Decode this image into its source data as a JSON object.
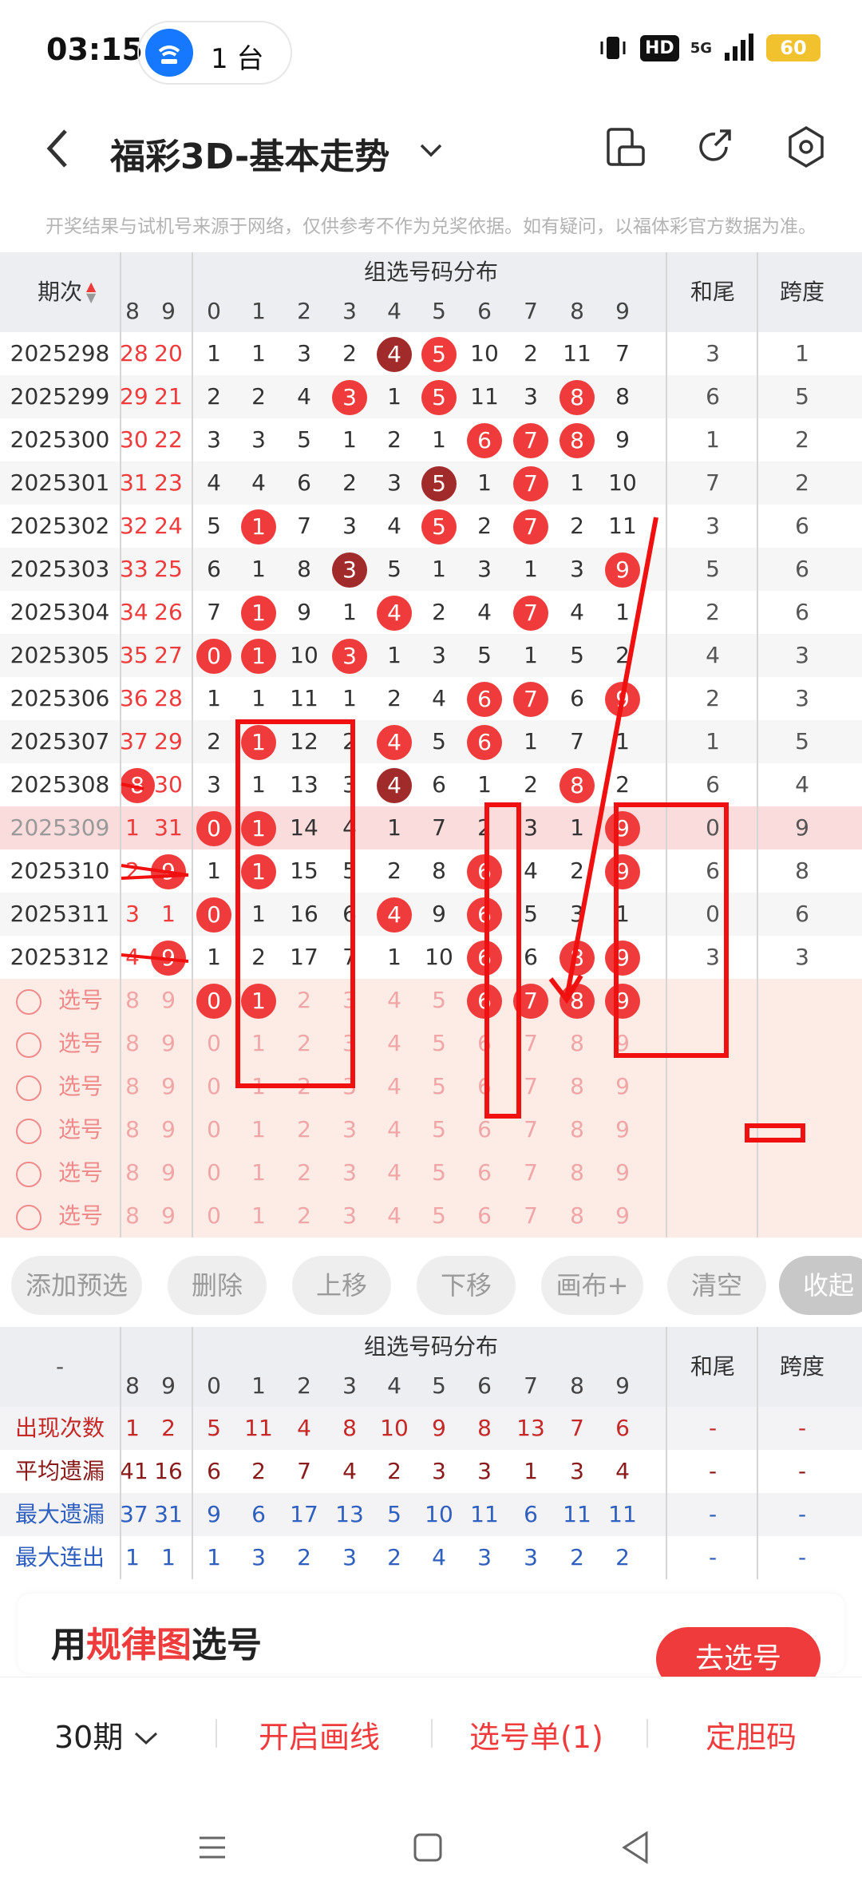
{
  "status": {
    "time": "03:15",
    "hotspot_count": "1 台",
    "network": "5G",
    "hd": "HD",
    "battery": "60"
  },
  "nav": {
    "title": "福彩3D-基本走势"
  },
  "notice": "开奖结果与试机号来源于网络，仅供参考不作为兑奖依据。如有疑问，以福体彩官方数据为准。",
  "table": {
    "col_period": "期次",
    "group_title": "组选号码分布",
    "col_sum_tail": "和尾",
    "col_span": "跨度",
    "sub_headers": [
      "8",
      "9",
      "0",
      "1",
      "2",
      "3",
      "4",
      "5",
      "6",
      "7",
      "8",
      "9"
    ],
    "rows": [
      {
        "period": "2025298",
        "c8": "28",
        "c9": "20",
        "d": [
          "1",
          "1",
          "3",
          "2",
          "4",
          "5",
          "10",
          "2",
          "11",
          "7"
        ],
        "tail": "3",
        "span": "1"
      },
      {
        "period": "2025299",
        "c8": "29",
        "c9": "21",
        "d": [
          "2",
          "2",
          "4",
          "3",
          "1",
          "5",
          "11",
          "3",
          "8",
          "8"
        ],
        "tail": "6",
        "span": "5"
      },
      {
        "period": "2025300",
        "c8": "30",
        "c9": "22",
        "d": [
          "3",
          "3",
          "5",
          "1",
          "2",
          "1",
          "6",
          "7",
          "8",
          "9"
        ],
        "tail": "1",
        "span": "2"
      },
      {
        "period": "2025301",
        "c8": "31",
        "c9": "23",
        "d": [
          "4",
          "4",
          "6",
          "2",
          "3",
          "5",
          "1",
          "7",
          "1",
          "10"
        ],
        "tail": "7",
        "span": "2"
      },
      {
        "period": "2025302",
        "c8": "32",
        "c9": "24",
        "d": [
          "5",
          "1",
          "7",
          "3",
          "4",
          "5",
          "2",
          "7",
          "2",
          "11"
        ],
        "tail": "3",
        "span": "6"
      },
      {
        "period": "2025303",
        "c8": "33",
        "c9": "25",
        "d": [
          "6",
          "1",
          "8",
          "3",
          "5",
          "1",
          "3",
          "1",
          "3",
          "9"
        ],
        "tail": "5",
        "span": "6"
      },
      {
        "period": "2025304",
        "c8": "34",
        "c9": "26",
        "d": [
          "7",
          "1",
          "9",
          "1",
          "4",
          "2",
          "4",
          "7",
          "4",
          "1"
        ],
        "tail": "2",
        "span": "6"
      },
      {
        "period": "2025305",
        "c8": "35",
        "c9": "27",
        "d": [
          "0",
          "1",
          "10",
          "3",
          "1",
          "3",
          "5",
          "1",
          "5",
          "2"
        ],
        "tail": "4",
        "span": "3"
      },
      {
        "period": "2025306",
        "c8": "36",
        "c9": "28",
        "d": [
          "1",
          "1",
          "11",
          "1",
          "2",
          "4",
          "6",
          "7",
          "6",
          "9"
        ],
        "tail": "2",
        "span": "3"
      },
      {
        "period": "2025307",
        "c8": "37",
        "c9": "29",
        "d": [
          "2",
          "1",
          "12",
          "2",
          "4",
          "5",
          "6",
          "1",
          "7",
          "1"
        ],
        "tail": "1",
        "span": "5"
      },
      {
        "period": "2025308",
        "c8": "8",
        "c9": "30",
        "d": [
          "3",
          "1",
          "13",
          "3",
          "4",
          "6",
          "1",
          "2",
          "8",
          "2"
        ],
        "tail": "6",
        "span": "4"
      },
      {
        "period": "2025309",
        "c8": "1",
        "c9": "31",
        "d": [
          "0",
          "1",
          "14",
          "4",
          "1",
          "7",
          "2",
          "3",
          "1",
          "9"
        ],
        "tail": "0",
        "span": "9"
      },
      {
        "period": "2025310",
        "c8": "2",
        "c9": "9",
        "d": [
          "1",
          "1",
          "15",
          "5",
          "2",
          "8",
          "6",
          "4",
          "2",
          "9"
        ],
        "tail": "6",
        "span": "8"
      },
      {
        "period": "2025311",
        "c8": "3",
        "c9": "1",
        "d": [
          "0",
          "1",
          "16",
          "6",
          "4",
          "9",
          "6",
          "5",
          "3",
          "1"
        ],
        "tail": "0",
        "span": "6"
      },
      {
        "period": "2025312",
        "c8": "4",
        "c9": "9",
        "d": [
          "1",
          "2",
          "17",
          "7",
          "1",
          "10",
          "6",
          "6",
          "8",
          "9"
        ],
        "tail": "3",
        "span": "3"
      }
    ],
    "select_label": "选号",
    "select_rows": 6
  },
  "buttons": [
    "添加预选",
    "删除",
    "上移",
    "下移",
    "画布+",
    "清空",
    "收起"
  ],
  "stats": {
    "dash": "-",
    "group_title": "组选号码分布",
    "col_sum_tail": "和尾",
    "col_span": "跨度",
    "rows": [
      {
        "label": "出现次数",
        "vals": [
          "1",
          "2",
          "5",
          "11",
          "4",
          "8",
          "10",
          "9",
          "8",
          "13",
          "7",
          "6"
        ],
        "tail": "-",
        "span": "-",
        "color": "#c62828"
      },
      {
        "label": "平均遗漏",
        "vals": [
          "41",
          "16",
          "6",
          "2",
          "7",
          "4",
          "2",
          "3",
          "3",
          "1",
          "3",
          "4"
        ],
        "tail": "-",
        "span": "-",
        "color": "#8b1a1a"
      },
      {
        "label": "最大遗漏",
        "vals": [
          "37",
          "31",
          "9",
          "6",
          "17",
          "13",
          "5",
          "10",
          "11",
          "6",
          "11",
          "11"
        ],
        "tail": "-",
        "span": "-",
        "color": "#2f5fbf"
      },
      {
        "label": "最大连出",
        "vals": [
          "1",
          "1",
          "1",
          "3",
          "2",
          "3",
          "2",
          "4",
          "3",
          "3",
          "2",
          "2"
        ],
        "tail": "-",
        "span": "-",
        "color": "#2f5fbf"
      }
    ]
  },
  "promo": {
    "prefix": "用",
    "highlight": "规律图",
    "suffix": "选号",
    "button": "去选号"
  },
  "bottom": {
    "period": "30期",
    "draw": "开启画线",
    "ticket": "选号单(1)",
    "fix": "定胆码"
  }
}
